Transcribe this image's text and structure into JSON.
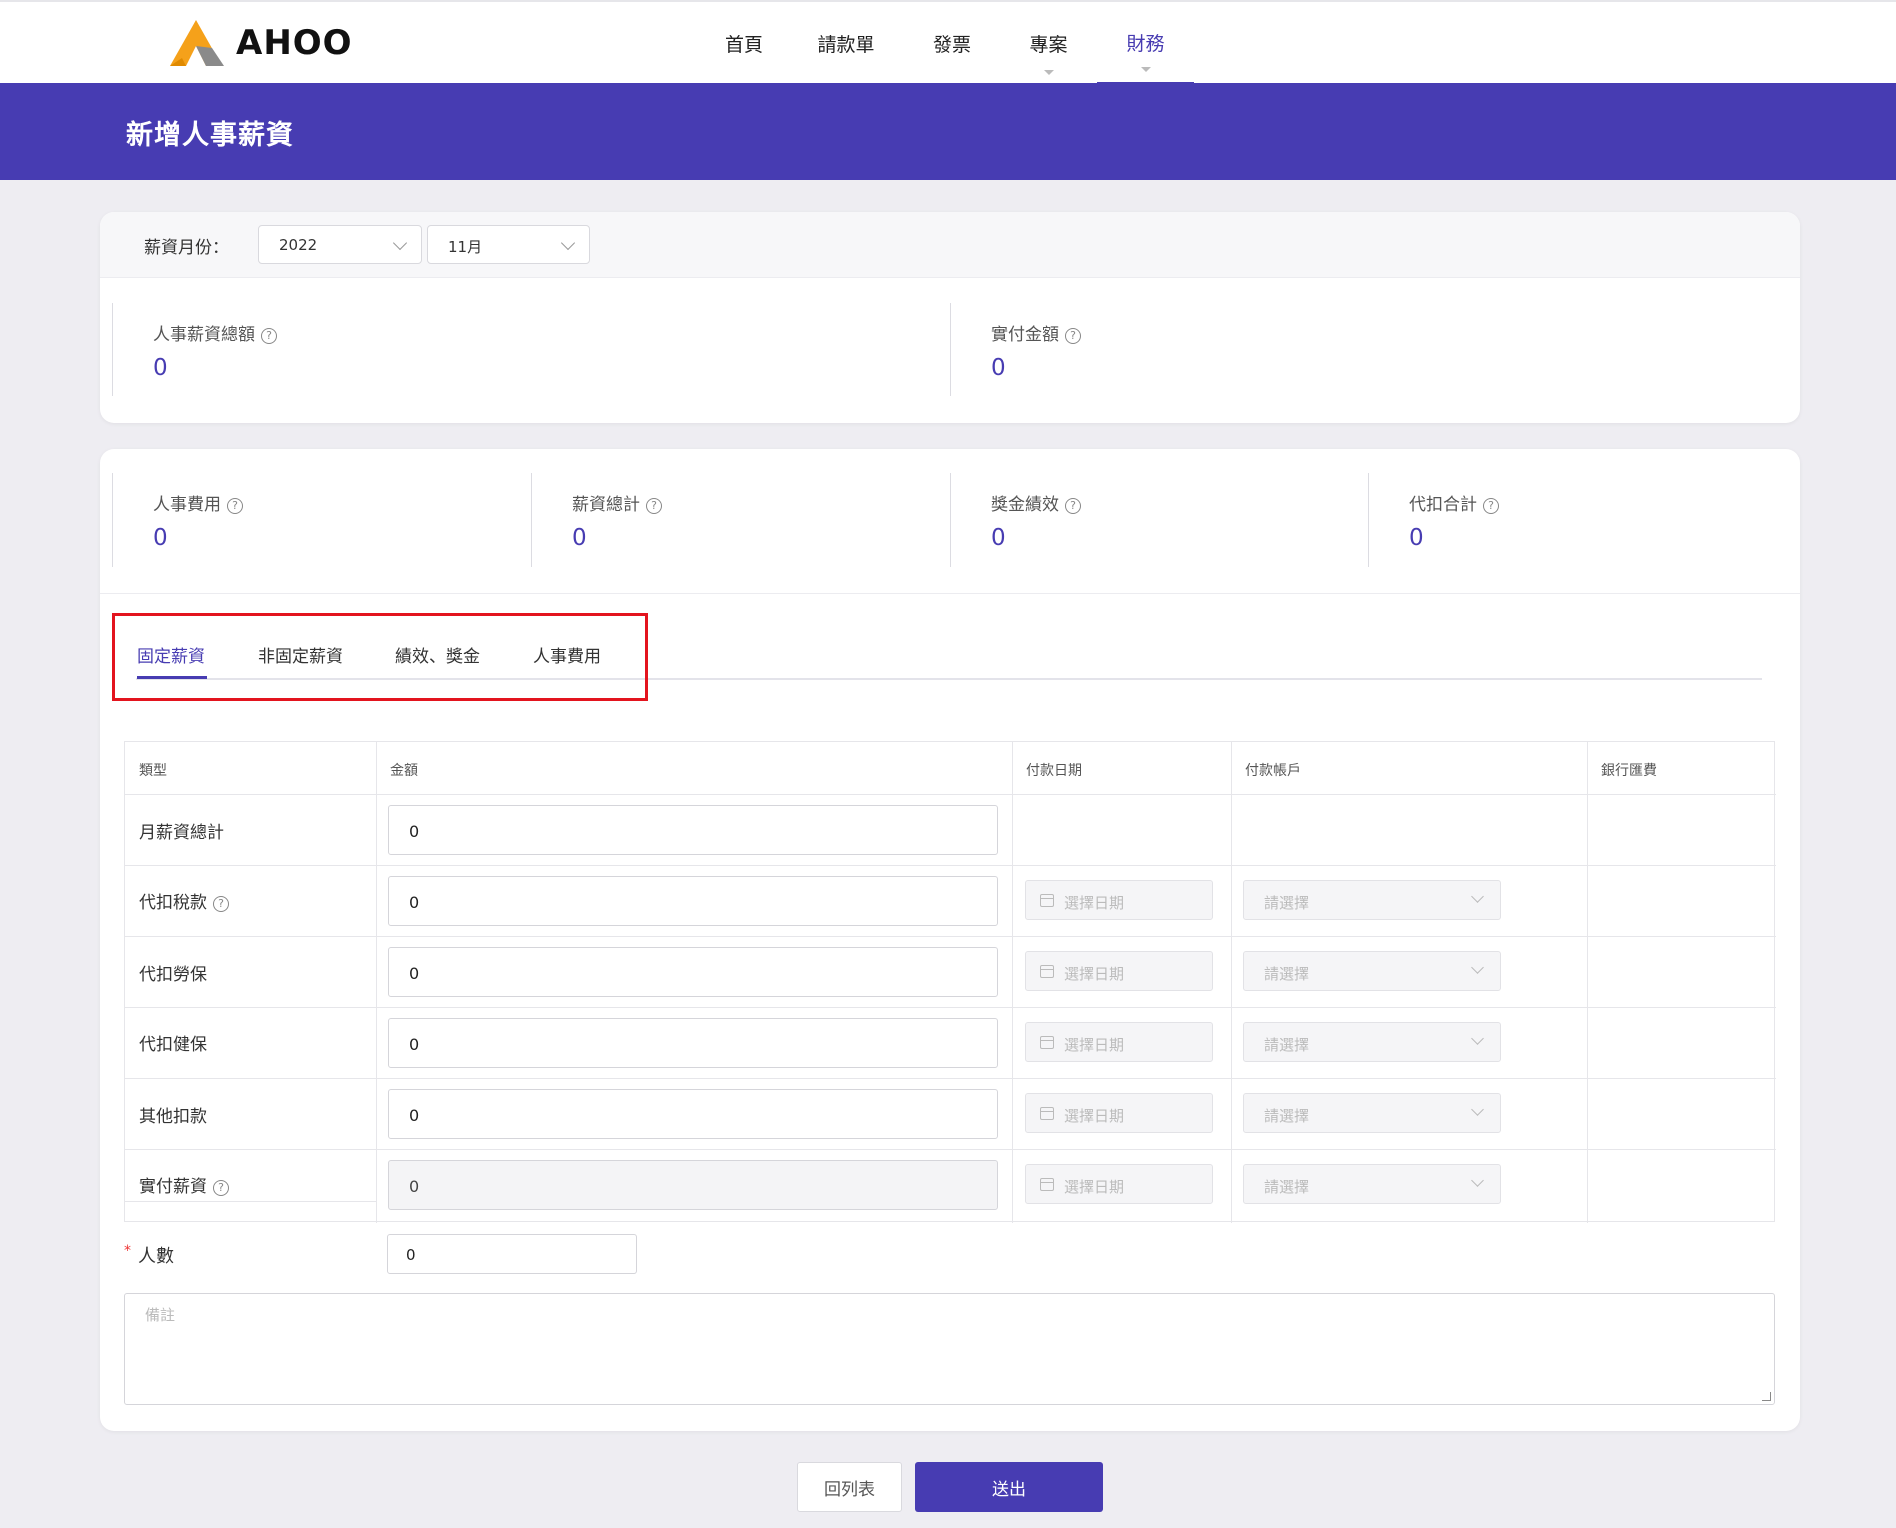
{
  "brand": {
    "name": "AHOO"
  },
  "nav": {
    "items": [
      {
        "label": "首頁",
        "has_dropdown": false,
        "active": false
      },
      {
        "label": "請款單",
        "has_dropdown": false,
        "active": false
      },
      {
        "label": "發票",
        "has_dropdown": false,
        "active": false
      },
      {
        "label": "專案",
        "has_dropdown": true,
        "active": false
      },
      {
        "label": "財務",
        "has_dropdown": true,
        "active": true
      }
    ]
  },
  "page": {
    "title": "新增人事薪資"
  },
  "period": {
    "label": "薪資月份：",
    "year": "2022",
    "month": "11月"
  },
  "summary": {
    "total": {
      "label": "人事薪資總額",
      "value": "0"
    },
    "paid": {
      "label": "實付金額",
      "value": "0"
    }
  },
  "breakdown": {
    "personnel_cost": {
      "label": "人事費用",
      "value": "0"
    },
    "salary_total": {
      "label": "薪資總計",
      "value": "0"
    },
    "bonus": {
      "label": "獎金績效",
      "value": "0"
    },
    "deduction_total": {
      "label": "代扣合計",
      "value": "0"
    }
  },
  "tabs": [
    {
      "label": "固定薪資",
      "active": true
    },
    {
      "label": "非固定薪資",
      "active": false
    },
    {
      "label": "績效、獎金",
      "active": false
    },
    {
      "label": "人事費用",
      "active": false
    }
  ],
  "table": {
    "headers": {
      "type": "類型",
      "amount": "金額",
      "pay_date": "付款日期",
      "pay_account": "付款帳戶",
      "bank_fee": "銀行匯費"
    },
    "date_placeholder": "選擇日期",
    "account_placeholder": "請選擇",
    "rows": [
      {
        "label": "月薪資總計",
        "amount": "0",
        "help": false
      },
      {
        "label": "代扣稅款",
        "amount": "0",
        "help": true
      },
      {
        "label": "代扣勞保",
        "amount": "0",
        "help": false
      },
      {
        "label": "代扣健保",
        "amount": "0",
        "help": false
      },
      {
        "label": "其他扣款",
        "amount": "0",
        "help": false
      },
      {
        "label": "實付薪資",
        "amount": "0",
        "help": true
      }
    ]
  },
  "headcount": {
    "label": "人數",
    "value": "0"
  },
  "notes": {
    "placeholder": "備註"
  },
  "buttons": {
    "back": "回列表",
    "submit": "送出"
  },
  "colors": {
    "primary": "#473cb2",
    "highlight": "#e3141e",
    "logo_orange": "#f5a11a",
    "logo_gray": "#8a8a8a"
  }
}
